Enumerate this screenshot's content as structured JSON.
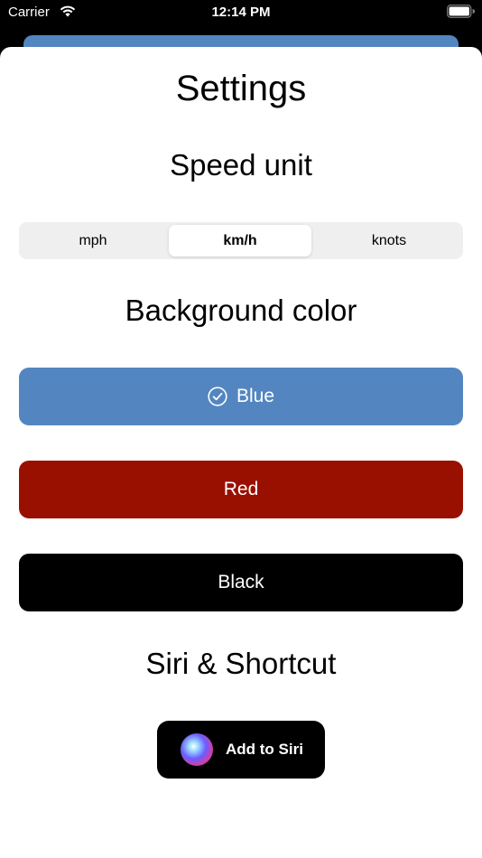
{
  "status_bar": {
    "carrier": "Carrier",
    "time": "12:14 PM",
    "wifi_icon": "wifi-icon",
    "battery_icon": "battery-icon"
  },
  "settings": {
    "title": "Settings",
    "speed_unit": {
      "heading": "Speed unit",
      "options": [
        "mph",
        "km/h",
        "knots"
      ],
      "selected": "km/h"
    },
    "background_color": {
      "heading": "Background color",
      "options": [
        {
          "label": "Blue",
          "color": "#5386c0",
          "selected": true,
          "icon": "checkmark-circle-icon"
        },
        {
          "label": "Red",
          "color": "#9a1000",
          "selected": false
        },
        {
          "label": "Black",
          "color": "#000000",
          "selected": false
        }
      ]
    },
    "siri": {
      "heading": "Siri & Shortcut",
      "button_label": "Add to Siri",
      "icon": "siri-icon"
    }
  },
  "colors": {
    "backdrop": "#000000",
    "sheet": "#ffffff",
    "segmented_bg": "#efeff0"
  }
}
